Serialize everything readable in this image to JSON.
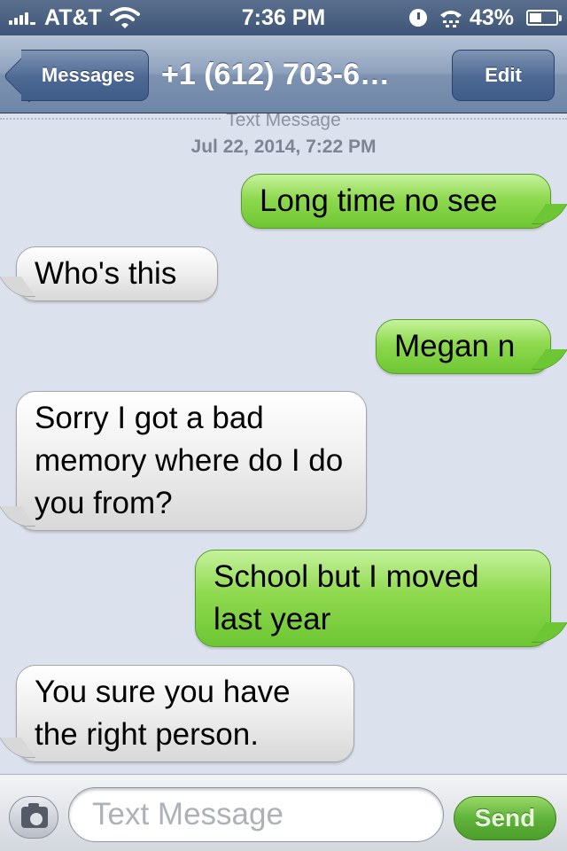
{
  "status_bar": {
    "carrier": "AT&T",
    "time": "7:36 PM",
    "battery_percent": "43%",
    "battery_level": 0.43
  },
  "nav": {
    "back_label": "Messages",
    "title": "+1 (612) 703-6…",
    "edit_label": "Edit"
  },
  "conversation": {
    "source_label": "Text Message",
    "timestamp": "Jul 22, 2014, 7:22 PM",
    "messages": [
      {
        "direction": "sent",
        "text": "Long time no see"
      },
      {
        "direction": "received",
        "text": "Who's this"
      },
      {
        "direction": "sent",
        "text": "Megan n"
      },
      {
        "direction": "received",
        "text": "Sorry I got a bad memory where do I do you from?"
      },
      {
        "direction": "sent",
        "text": "School but I moved last year"
      },
      {
        "direction": "received",
        "text": "You sure you have the right person."
      }
    ]
  },
  "compose": {
    "placeholder": "Text Message",
    "value": "",
    "send_label": "Send"
  },
  "colors": {
    "sent_bubble": "#8fd94f",
    "received_bubble": "#f0f0f0",
    "background": "#dbe1ed",
    "nav_bar": "#7d92b0"
  },
  "icons": {
    "camera": "camera-icon",
    "wifi": "wifi-icon",
    "signal": "signal-strength-icon",
    "battery": "battery-icon",
    "lock": "rotation-lock-icon",
    "tty": "tty-icon"
  }
}
